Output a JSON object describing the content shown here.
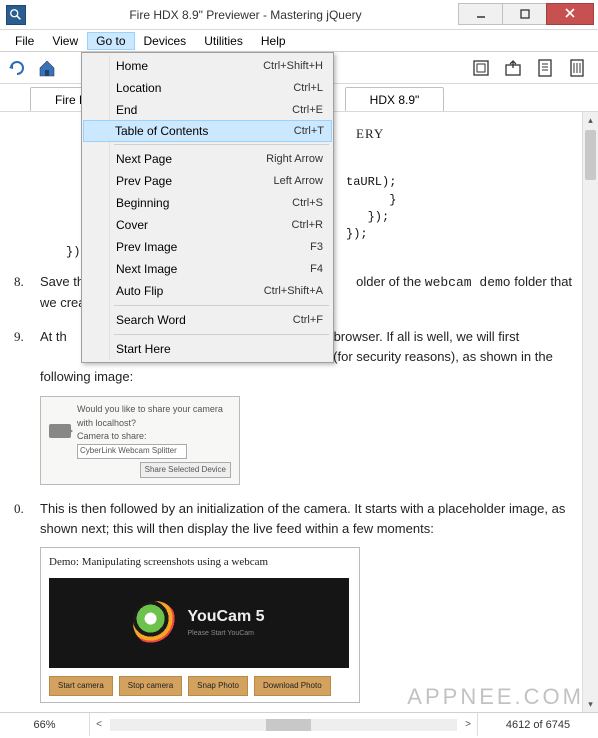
{
  "titlebar": {
    "title": "Fire HDX 8.9\" Previewer - Mastering jQuery"
  },
  "menubar": {
    "items": [
      "File",
      "View",
      "Go to",
      "Devices",
      "Utilities",
      "Help"
    ],
    "active_index": 2
  },
  "tabs": {
    "left": "Fire H",
    "right": "HDX 8.9\""
  },
  "dropdown": {
    "groups": [
      [
        {
          "label": "Home",
          "shortcut": "Ctrl+Shift+H"
        },
        {
          "label": "Location",
          "shortcut": "Ctrl+L"
        },
        {
          "label": "End",
          "shortcut": "Ctrl+E"
        },
        {
          "label": "Table of Contents",
          "shortcut": "Ctrl+T",
          "highlight": true
        }
      ],
      [
        {
          "label": "Next Page",
          "shortcut": "Right Arrow"
        },
        {
          "label": "Prev Page",
          "shortcut": "Left Arrow"
        },
        {
          "label": "Beginning",
          "shortcut": "Ctrl+S"
        },
        {
          "label": "Cover",
          "shortcut": "Ctrl+R"
        },
        {
          "label": "Prev Image",
          "shortcut": "F3"
        },
        {
          "label": "Next Image",
          "shortcut": "F4"
        },
        {
          "label": "Auto Flip",
          "shortcut": "Ctrl+Shift+A"
        }
      ],
      [
        {
          "label": "Search Word",
          "shortcut": "Ctrl+F"
        }
      ],
      [
        {
          "label": "Start Here",
          "shortcut": ""
        }
      ]
    ]
  },
  "content": {
    "heading": "ERY",
    "code_frag": "taURL);\n      }\n   });\n});",
    "li8_a": "Save the file as ",
    "li8_b": "older of the ",
    "li8_mono": "webcam demo",
    "li8_c": " folder that we created earlier in step 1.",
    "li9_a": "At th",
    "li9_b": "in a browser. If all is well, we will first",
    "li9_c": "o the webcam (for security reasons), as shown in the following image:",
    "imgbox1": {
      "line1": "Would you like to share your camera with localhost?",
      "line2": "Camera to share:",
      "field": "CyberLink Webcam Splitter",
      "btn": "Share Selected Device"
    },
    "li10": "This is then followed by an initialization of the camera. It starts with a placeholder image, as shown next; this will then display the live feed within a few moments:",
    "demohead": "Demo: Manipulating screenshots using a webcam",
    "youcam_brand": "YouCam 5",
    "youcam_sub": "Please Start YouCam",
    "demo_btns": [
      "Start camera",
      "Stop camera",
      "Snap Photo",
      "Download Photo"
    ]
  },
  "statusbar": {
    "zoom": "66%",
    "pages": "4612 of 6745"
  },
  "watermark": "APPNEE.COM"
}
